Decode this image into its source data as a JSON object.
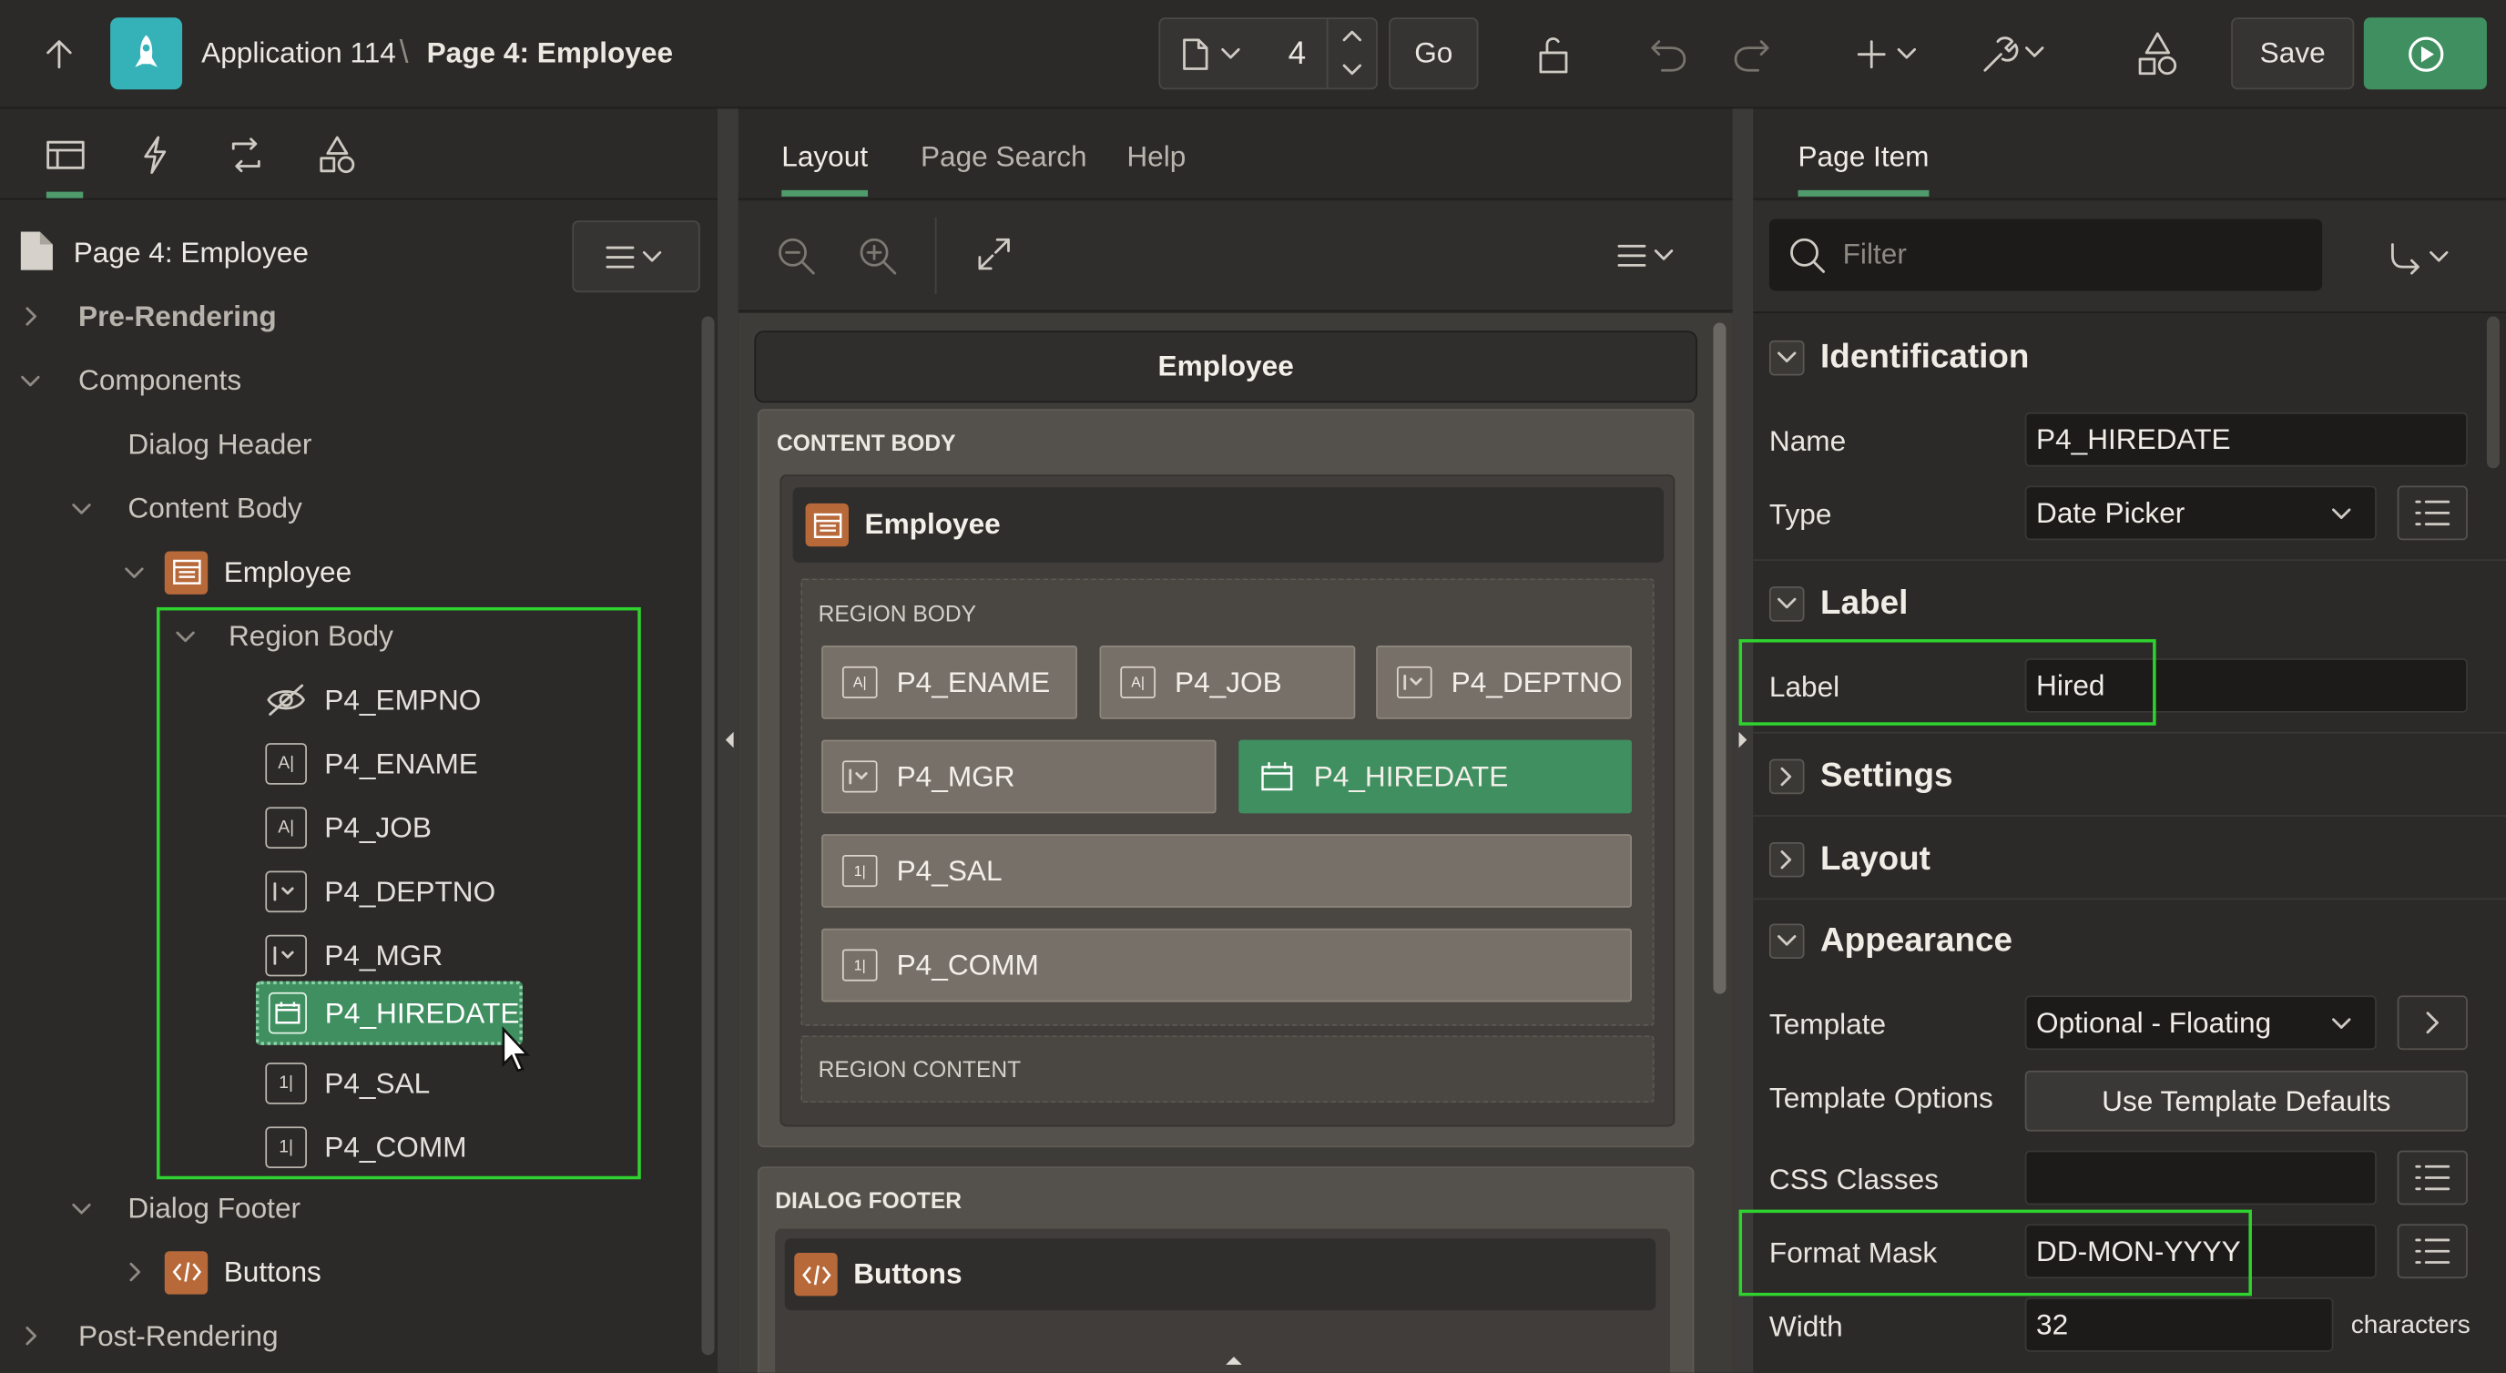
{
  "header": {
    "app_name": "Application 114",
    "separator": "\\",
    "page_name": "Page 4: Employee",
    "page_number": "4",
    "go_label": "Go",
    "save_label": "Save"
  },
  "left_panel": {
    "page_title": "Page 4: Employee",
    "tree": {
      "pre_rendering": "Pre-Rendering",
      "components": "Components",
      "dialog_header": "Dialog Header",
      "content_body": "Content Body",
      "employee": "Employee",
      "region_body": "Region Body",
      "items": [
        "P4_EMPNO",
        "P4_ENAME",
        "P4_JOB",
        "P4_DEPTNO",
        "P4_MGR",
        "P4_HIREDATE",
        "P4_SAL",
        "P4_COMM"
      ],
      "dialog_footer": "Dialog Footer",
      "buttons": "Buttons",
      "post_rendering": "Post-Rendering"
    }
  },
  "center_panel": {
    "tabs": [
      "Layout",
      "Page Search",
      "Help"
    ],
    "dialog_title": "Employee",
    "content_body_label": "CONTENT BODY",
    "region_title": "Employee",
    "region_body_label": "REGION BODY",
    "items": {
      "ename": "P4_ENAME",
      "job": "P4_JOB",
      "deptno": "P4_DEPTNO",
      "mgr": "P4_MGR",
      "hiredate": "P4_HIREDATE",
      "sal": "P4_SAL",
      "comm": "P4_COMM"
    },
    "region_content_label": "REGION CONTENT",
    "dialog_footer_label": "DIALOG FOOTER",
    "buttons_label": "Buttons"
  },
  "right_panel": {
    "tab": "Page Item",
    "filter_placeholder": "Filter",
    "sections": {
      "identification": "Identification",
      "label": "Label",
      "settings": "Settings",
      "layout": "Layout",
      "appearance": "Appearance"
    },
    "props": {
      "name_label": "Name",
      "name_value": "P4_HIREDATE",
      "type_label": "Type",
      "type_value": "Date Picker",
      "label_label": "Label",
      "label_value": "Hired",
      "template_label": "Template",
      "template_value": "Optional - Floating",
      "template_options_label": "Template Options",
      "template_options_button": "Use Template Defaults",
      "css_classes_label": "CSS Classes",
      "css_classes_value": "",
      "format_mask_label": "Format Mask",
      "format_mask_value": "DD-MON-YYYY",
      "width_label": "Width",
      "width_value": "32",
      "width_unit": "characters"
    }
  },
  "colors": {
    "accent_green": "#3f8f60",
    "highlight_green": "#2fd22f",
    "region_orange": "#b8693a",
    "app_icon_teal": "#35b2b8"
  }
}
